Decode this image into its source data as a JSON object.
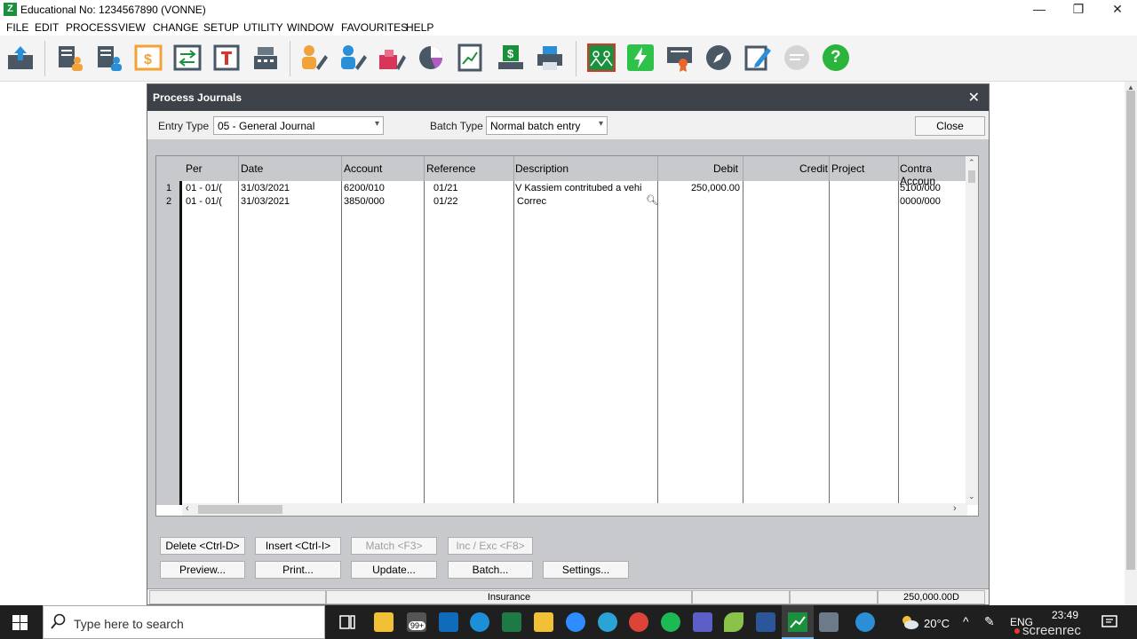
{
  "window": {
    "title": "Educational No: 1234567890 (VONNE)",
    "minimize_glyph": "—",
    "restore_glyph": "❐",
    "close_glyph": "✕"
  },
  "menu": [
    "FILE",
    "EDIT",
    "PROCESS",
    "VIEW",
    "CHANGE",
    "SETUP",
    "UTILITY",
    "WINDOW",
    "FAVOURITES",
    "HELP"
  ],
  "toolbar": {
    "icons": [
      "export-icon",
      "customer-icon",
      "supplier-icon",
      "cashbook-icon",
      "transfer-icon",
      "document-icon",
      "cash-register-icon",
      "user-edit-icon",
      "user-pencil-icon",
      "inventory-icon",
      "pie-chart-icon",
      "trend-report-icon",
      "banking-icon",
      "printer-icon",
      "team-icon",
      "lightning-icon",
      "certificate-icon",
      "compass-icon",
      "edit-icon",
      "chat-icon",
      "help-icon"
    ],
    "help_label": "?"
  },
  "dialog": {
    "title": "Process Journals",
    "close_glyph": "✕",
    "entry_type_label": "Entry Type",
    "entry_type_value": "05 - General Journal",
    "batch_type_label": "Batch Type",
    "batch_type_value": "Normal batch entry",
    "close_button": "Close"
  },
  "grid": {
    "columns": [
      "Per",
      "Date",
      "Account",
      "Reference",
      "Description",
      "Debit",
      "Credit",
      "Project",
      "Contra Accoun"
    ],
    "rows": [
      {
        "num": "1",
        "per": "01 - 01/(",
        "date": "31/03/2021",
        "account": "6200/010",
        "reference": "01/21",
        "description": "V Kassiem contritubed a vehi",
        "debit": "250,000.00",
        "credit": "",
        "project": "",
        "contra": "5100/000"
      },
      {
        "num": "2",
        "per": "01 - 01/(",
        "date": "31/03/2021",
        "account": "3850/000",
        "reference": "01/22",
        "description": "Correc",
        "debit": "",
        "credit": "",
        "project": "",
        "contra": "0000/000"
      }
    ]
  },
  "buttons": {
    "row1": [
      "Delete <Ctrl-D>",
      "Insert <Ctrl-I>",
      "Match <F3>",
      "Inc / Exc <F8>"
    ],
    "row2": [
      "Preview...",
      "Print...",
      "Update...",
      "Batch...",
      "Settings..."
    ]
  },
  "status": {
    "account_name": "Insurance",
    "total": "250,000.00D"
  },
  "taskbar": {
    "search_placeholder": "Type here to search",
    "badge": "99+",
    "temperature": "20°C",
    "language": "ENG",
    "time": "23:49",
    "watermark": "screenrec"
  }
}
